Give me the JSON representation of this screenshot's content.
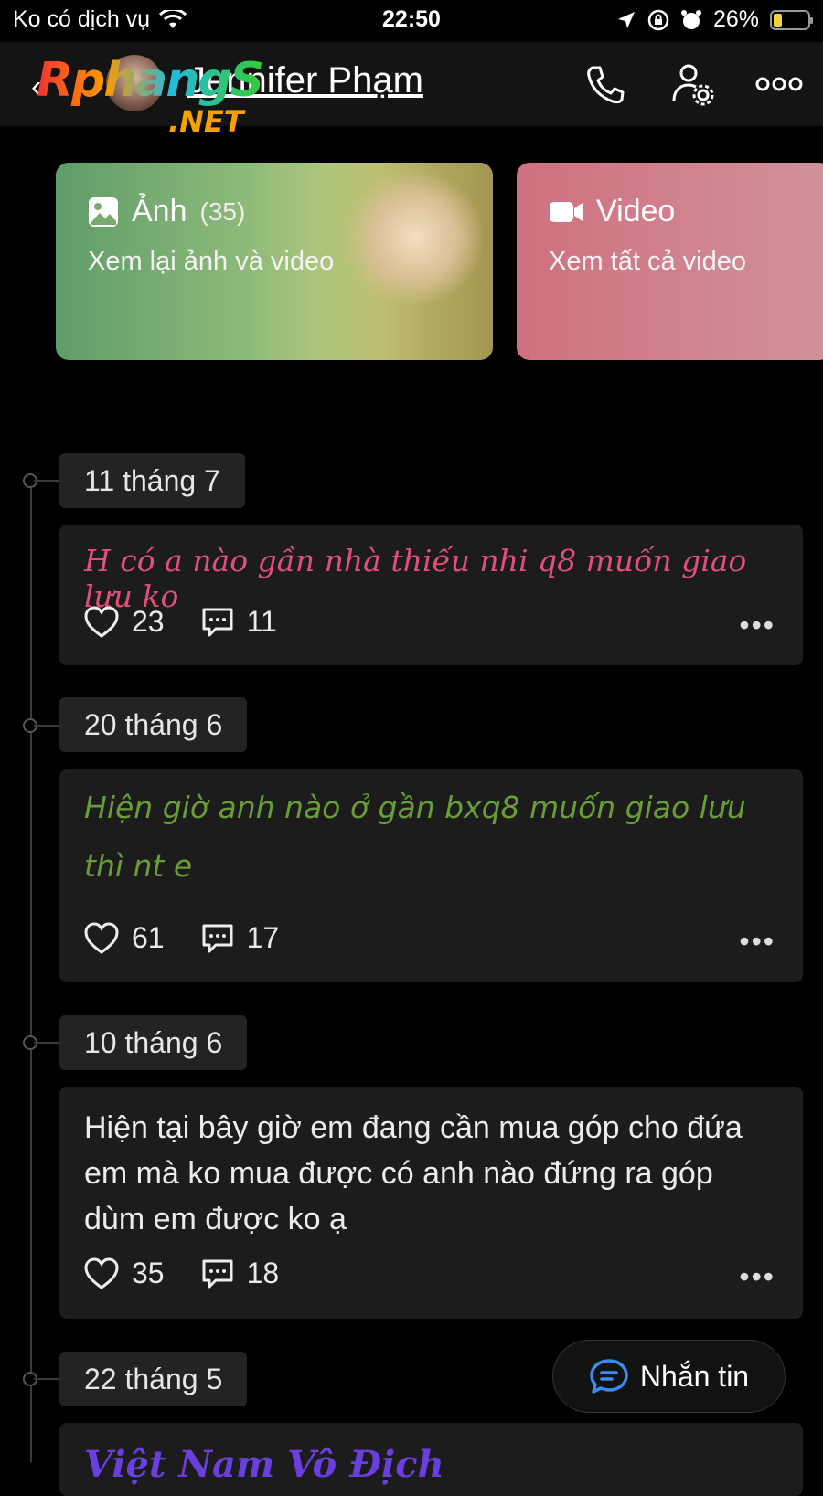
{
  "status": {
    "carrier": "Ko có dịch vụ",
    "time": "22:50",
    "battery": "26%",
    "battery_level": 0.26
  },
  "header": {
    "name": "Jennifer Phạm",
    "watermark_main": "Rphang",
    "watermark_s": "S",
    "watermark_net": ".NET"
  },
  "cards": [
    {
      "title": "Ảnh",
      "count": "(35)",
      "subtitle": "Xem lại ảnh và video",
      "icon": "image-icon"
    },
    {
      "title": "Video",
      "subtitle": "Xem tất cả video",
      "icon": "video-camera-icon"
    }
  ],
  "posts": [
    {
      "date": "11 tháng 7",
      "text": "H có a nào gần nhà thiếu nhi q8 muốn giao lưu ko",
      "likes": "23",
      "comments": "11",
      "style": "pink"
    },
    {
      "date": "20 tháng 6",
      "text": "Hiện giờ anh nào ở gần bxq8 muốn giao lưu thì nt e",
      "likes": "61",
      "comments": "17",
      "style": "green"
    },
    {
      "date": "10 tháng 6",
      "text": "Hiện tại bây giờ em đang cần mua góp cho đứa em mà ko mua được có anh nào đứng ra góp dùm em được ko ạ",
      "likes": "35",
      "comments": "18",
      "style": "white"
    },
    {
      "date": "22 tháng 5",
      "text": "Việt Nam Vô Địch",
      "style": "purple"
    }
  ],
  "fab": {
    "label": "Nhắn tin"
  },
  "colors": {
    "pink": "#e0507a",
    "green": "#6a9d38",
    "purple": "#6a3fe0",
    "accent": "#3b8cf0"
  }
}
